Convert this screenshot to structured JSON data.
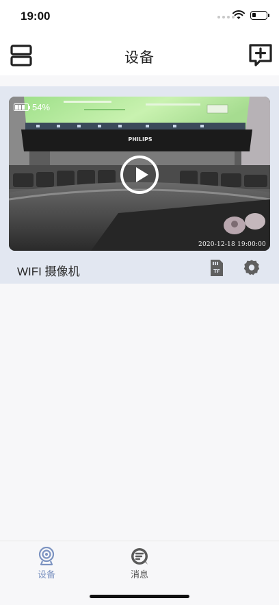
{
  "status_bar": {
    "time": "19:00",
    "icons": [
      "signal-dots-icon",
      "wifi-icon",
      "battery-icon"
    ]
  },
  "nav": {
    "title": "设备",
    "left_icon": "scan-icon",
    "right_icon": "add-device-icon"
  },
  "device_card": {
    "battery_percent": "54%",
    "timestamp": "2020-12-18 19:00:00",
    "monitor_brand": "PHILIPS",
    "device_name": "WIFI 摄像机",
    "play_icon": "play-icon",
    "tf_label": "TF",
    "settings_icon": "gear-icon"
  },
  "tab_bar": {
    "items": [
      {
        "label": "设备",
        "icon": "camera-icon",
        "active": true
      },
      {
        "label": "消息",
        "icon": "message-icon",
        "active": false
      }
    ]
  },
  "colors": {
    "accent": "#7c93c1",
    "card_background": "#e2e7f1",
    "page_background": "#f7f7f9"
  }
}
